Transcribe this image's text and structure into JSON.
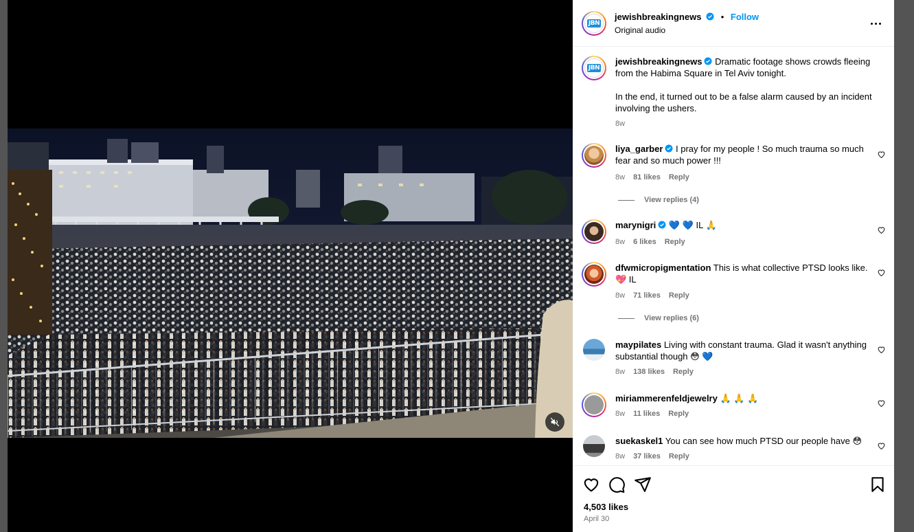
{
  "header": {
    "username": "jewishbreakingnews",
    "dot": "•",
    "follow_label": "Follow",
    "audio_label": "Original audio"
  },
  "caption": {
    "username": "jewishbreakingnews",
    "text_p1": "Dramatic footage shows crowds fleeing from the Habima Square in Tel Aviv tonight.",
    "text_p2": "In the end, it turned out to be a false alarm caused by an incident involving the ushers.",
    "age": "8w"
  },
  "comments": [
    {
      "username": "liya_garber",
      "verified": true,
      "text": "I pray for my people ! So much trauma so much fear and so much power !!!",
      "age": "8w",
      "likes": "81 likes",
      "reply": "Reply",
      "view_replies": "View replies (4)"
    },
    {
      "username": "marynigri",
      "verified": true,
      "text": "💙 💙 IL 🙏",
      "age": "8w",
      "likes": "6 likes",
      "reply": "Reply"
    },
    {
      "username": "dfwmicropigmentation",
      "verified": false,
      "text": "This is what collective PTSD looks like. 💖 IL",
      "age": "8w",
      "likes": "71 likes",
      "reply": "Reply",
      "view_replies": "View replies (6)"
    },
    {
      "username": "maypilates",
      "verified": false,
      "text": "Living with constant trauma. Glad it wasn't anything substantial though 😳 💙",
      "age": "8w",
      "likes": "138 likes",
      "reply": "Reply"
    },
    {
      "username": "miriammerenfeldjewelry",
      "verified": false,
      "text": "🙏 🙏 🙏",
      "age": "8w",
      "likes": "11 likes",
      "reply": "Reply"
    },
    {
      "username": "suekaskel1",
      "verified": false,
      "text": "You can see how much PTSD our people have 😳",
      "age": "8w",
      "likes": "37 likes",
      "reply": "Reply"
    }
  ],
  "footer": {
    "likes_total": "4,503 likes",
    "date": "April 30"
  },
  "icons": {
    "verified": "verified-badge",
    "mute": "speaker-muted-icon",
    "more": "more-options-icon",
    "like": "heart-icon",
    "comment": "speech-bubble-icon",
    "share": "paper-plane-icon",
    "save": "bookmark-icon"
  },
  "colors": {
    "accent": "#0095f6",
    "verified": "#0095f6",
    "muted_text": "#737373",
    "video_bg": "#000000"
  }
}
